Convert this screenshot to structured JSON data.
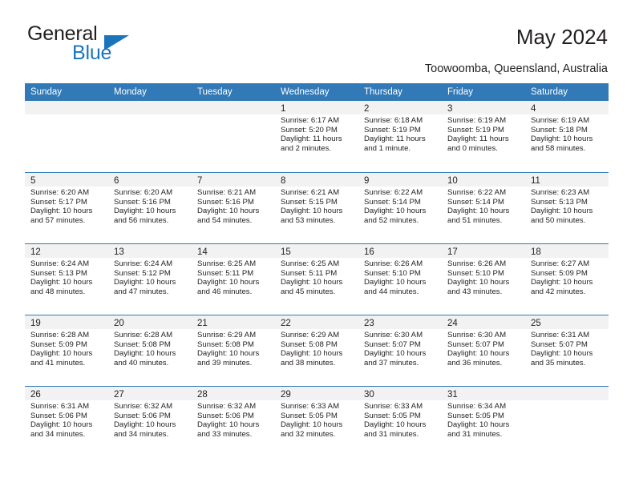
{
  "brand": {
    "word1": "General",
    "word2": "Blue",
    "triangle_color": "#1b75bb",
    "icon": "triangle-icon"
  },
  "header": {
    "title": "May 2024",
    "subtitle": "Toowoomba, Queensland, Australia"
  },
  "colors": {
    "header_blue": "#3279b7",
    "daynum_band": "#f2f2f2",
    "text": "#231f20",
    "brand_blue": "#1b75bb"
  },
  "labels": {
    "sunrise": "Sunrise:",
    "sunset": "Sunset:",
    "daylight": "Daylight:"
  },
  "days_of_week": [
    "Sunday",
    "Monday",
    "Tuesday",
    "Wednesday",
    "Thursday",
    "Friday",
    "Saturday"
  ],
  "weeks": [
    [
      {
        "day": "",
        "sunrise": "",
        "sunset": "",
        "daylight_line1": "",
        "daylight_line2": ""
      },
      {
        "day": "",
        "sunrise": "",
        "sunset": "",
        "daylight_line1": "",
        "daylight_line2": ""
      },
      {
        "day": "",
        "sunrise": "",
        "sunset": "",
        "daylight_line1": "",
        "daylight_line2": ""
      },
      {
        "day": "1",
        "sunrise": "Sunrise: 6:17 AM",
        "sunset": "Sunset: 5:20 PM",
        "daylight_line1": "Daylight: 11 hours",
        "daylight_line2": "and 2 minutes."
      },
      {
        "day": "2",
        "sunrise": "Sunrise: 6:18 AM",
        "sunset": "Sunset: 5:19 PM",
        "daylight_line1": "Daylight: 11 hours",
        "daylight_line2": "and 1 minute."
      },
      {
        "day": "3",
        "sunrise": "Sunrise: 6:19 AM",
        "sunset": "Sunset: 5:19 PM",
        "daylight_line1": "Daylight: 11 hours",
        "daylight_line2": "and 0 minutes."
      },
      {
        "day": "4",
        "sunrise": "Sunrise: 6:19 AM",
        "sunset": "Sunset: 5:18 PM",
        "daylight_line1": "Daylight: 10 hours",
        "daylight_line2": "and 58 minutes."
      }
    ],
    [
      {
        "day": "5",
        "sunrise": "Sunrise: 6:20 AM",
        "sunset": "Sunset: 5:17 PM",
        "daylight_line1": "Daylight: 10 hours",
        "daylight_line2": "and 57 minutes."
      },
      {
        "day": "6",
        "sunrise": "Sunrise: 6:20 AM",
        "sunset": "Sunset: 5:16 PM",
        "daylight_line1": "Daylight: 10 hours",
        "daylight_line2": "and 56 minutes."
      },
      {
        "day": "7",
        "sunrise": "Sunrise: 6:21 AM",
        "sunset": "Sunset: 5:16 PM",
        "daylight_line1": "Daylight: 10 hours",
        "daylight_line2": "and 54 minutes."
      },
      {
        "day": "8",
        "sunrise": "Sunrise: 6:21 AM",
        "sunset": "Sunset: 5:15 PM",
        "daylight_line1": "Daylight: 10 hours",
        "daylight_line2": "and 53 minutes."
      },
      {
        "day": "9",
        "sunrise": "Sunrise: 6:22 AM",
        "sunset": "Sunset: 5:14 PM",
        "daylight_line1": "Daylight: 10 hours",
        "daylight_line2": "and 52 minutes."
      },
      {
        "day": "10",
        "sunrise": "Sunrise: 6:22 AM",
        "sunset": "Sunset: 5:14 PM",
        "daylight_line1": "Daylight: 10 hours",
        "daylight_line2": "and 51 minutes."
      },
      {
        "day": "11",
        "sunrise": "Sunrise: 6:23 AM",
        "sunset": "Sunset: 5:13 PM",
        "daylight_line1": "Daylight: 10 hours",
        "daylight_line2": "and 50 minutes."
      }
    ],
    [
      {
        "day": "12",
        "sunrise": "Sunrise: 6:24 AM",
        "sunset": "Sunset: 5:13 PM",
        "daylight_line1": "Daylight: 10 hours",
        "daylight_line2": "and 48 minutes."
      },
      {
        "day": "13",
        "sunrise": "Sunrise: 6:24 AM",
        "sunset": "Sunset: 5:12 PM",
        "daylight_line1": "Daylight: 10 hours",
        "daylight_line2": "and 47 minutes."
      },
      {
        "day": "14",
        "sunrise": "Sunrise: 6:25 AM",
        "sunset": "Sunset: 5:11 PM",
        "daylight_line1": "Daylight: 10 hours",
        "daylight_line2": "and 46 minutes."
      },
      {
        "day": "15",
        "sunrise": "Sunrise: 6:25 AM",
        "sunset": "Sunset: 5:11 PM",
        "daylight_line1": "Daylight: 10 hours",
        "daylight_line2": "and 45 minutes."
      },
      {
        "day": "16",
        "sunrise": "Sunrise: 6:26 AM",
        "sunset": "Sunset: 5:10 PM",
        "daylight_line1": "Daylight: 10 hours",
        "daylight_line2": "and 44 minutes."
      },
      {
        "day": "17",
        "sunrise": "Sunrise: 6:26 AM",
        "sunset": "Sunset: 5:10 PM",
        "daylight_line1": "Daylight: 10 hours",
        "daylight_line2": "and 43 minutes."
      },
      {
        "day": "18",
        "sunrise": "Sunrise: 6:27 AM",
        "sunset": "Sunset: 5:09 PM",
        "daylight_line1": "Daylight: 10 hours",
        "daylight_line2": "and 42 minutes."
      }
    ],
    [
      {
        "day": "19",
        "sunrise": "Sunrise: 6:28 AM",
        "sunset": "Sunset: 5:09 PM",
        "daylight_line1": "Daylight: 10 hours",
        "daylight_line2": "and 41 minutes."
      },
      {
        "day": "20",
        "sunrise": "Sunrise: 6:28 AM",
        "sunset": "Sunset: 5:08 PM",
        "daylight_line1": "Daylight: 10 hours",
        "daylight_line2": "and 40 minutes."
      },
      {
        "day": "21",
        "sunrise": "Sunrise: 6:29 AM",
        "sunset": "Sunset: 5:08 PM",
        "daylight_line1": "Daylight: 10 hours",
        "daylight_line2": "and 39 minutes."
      },
      {
        "day": "22",
        "sunrise": "Sunrise: 6:29 AM",
        "sunset": "Sunset: 5:08 PM",
        "daylight_line1": "Daylight: 10 hours",
        "daylight_line2": "and 38 minutes."
      },
      {
        "day": "23",
        "sunrise": "Sunrise: 6:30 AM",
        "sunset": "Sunset: 5:07 PM",
        "daylight_line1": "Daylight: 10 hours",
        "daylight_line2": "and 37 minutes."
      },
      {
        "day": "24",
        "sunrise": "Sunrise: 6:30 AM",
        "sunset": "Sunset: 5:07 PM",
        "daylight_line1": "Daylight: 10 hours",
        "daylight_line2": "and 36 minutes."
      },
      {
        "day": "25",
        "sunrise": "Sunrise: 6:31 AM",
        "sunset": "Sunset: 5:07 PM",
        "daylight_line1": "Daylight: 10 hours",
        "daylight_line2": "and 35 minutes."
      }
    ],
    [
      {
        "day": "26",
        "sunrise": "Sunrise: 6:31 AM",
        "sunset": "Sunset: 5:06 PM",
        "daylight_line1": "Daylight: 10 hours",
        "daylight_line2": "and 34 minutes."
      },
      {
        "day": "27",
        "sunrise": "Sunrise: 6:32 AM",
        "sunset": "Sunset: 5:06 PM",
        "daylight_line1": "Daylight: 10 hours",
        "daylight_line2": "and 34 minutes."
      },
      {
        "day": "28",
        "sunrise": "Sunrise: 6:32 AM",
        "sunset": "Sunset: 5:06 PM",
        "daylight_line1": "Daylight: 10 hours",
        "daylight_line2": "and 33 minutes."
      },
      {
        "day": "29",
        "sunrise": "Sunrise: 6:33 AM",
        "sunset": "Sunset: 5:05 PM",
        "daylight_line1": "Daylight: 10 hours",
        "daylight_line2": "and 32 minutes."
      },
      {
        "day": "30",
        "sunrise": "Sunrise: 6:33 AM",
        "sunset": "Sunset: 5:05 PM",
        "daylight_line1": "Daylight: 10 hours",
        "daylight_line2": "and 31 minutes."
      },
      {
        "day": "31",
        "sunrise": "Sunrise: 6:34 AM",
        "sunset": "Sunset: 5:05 PM",
        "daylight_line1": "Daylight: 10 hours",
        "daylight_line2": "and 31 minutes."
      },
      {
        "day": "",
        "sunrise": "",
        "sunset": "",
        "daylight_line1": "",
        "daylight_line2": ""
      }
    ]
  ]
}
